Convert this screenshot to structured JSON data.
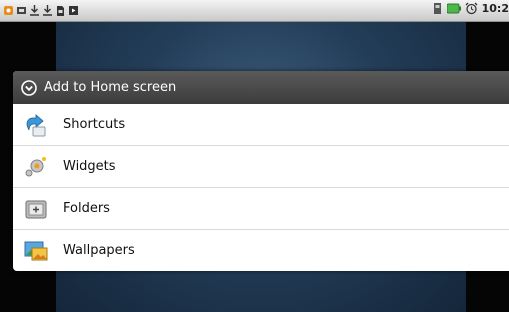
{
  "status_bar": {
    "time": "10:2",
    "left_icons": [
      "app-notification-icon",
      "usb-icon",
      "download-icon",
      "download-icon",
      "sd-card-icon",
      "play-icon"
    ],
    "right_icons": [
      "sim-icon",
      "battery-icon",
      "alarm-clock-icon"
    ]
  },
  "dialog": {
    "title": "Add to Home screen",
    "title_icon": "add-circle-icon",
    "options": [
      {
        "label": "Shortcuts",
        "icon": "shortcut-icon"
      },
      {
        "label": "Widgets",
        "icon": "widget-icon"
      },
      {
        "label": "Folders",
        "icon": "folder-icon"
      },
      {
        "label": "Wallpapers",
        "icon": "wallpaper-icon"
      }
    ]
  },
  "colors": {
    "dialog_title_bg": "#4a4a4a",
    "dialog_bg": "#ffffff",
    "wallpaper": "#233d58",
    "status_bar": "#e0e0e0"
  }
}
